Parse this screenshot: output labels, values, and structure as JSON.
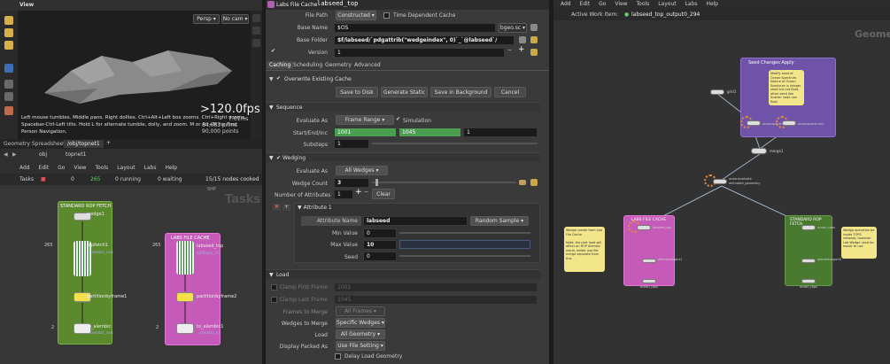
{
  "viewport": {
    "title": "View",
    "persp": "Persp",
    "cam": "No cam",
    "fps": ">120.0fps",
    "ms": "7.01ms",
    "stats1": "84,681   prims",
    "stats2": "90,000  points",
    "hint": "Left mouse tumbles. Middle pans. Right dollies. Ctrl+Alt+Left box zooms. Ctrl+Right zooms. Spacebar-Ctrl-Left tilts. Hold L for alternate tumble, dolly, and zoom. M or Alt+M for First Person Navigation."
  },
  "network_left": {
    "tabs": [
      "Geometry Spreadsheet",
      "/obj/topnet1"
    ],
    "path": [
      "obj",
      "topnet1"
    ],
    "menu": [
      "Add",
      "Edit",
      "Go",
      "View",
      "Tools",
      "Layout",
      "Labs",
      "Help"
    ],
    "tasks_label": "Tasks",
    "counts": [
      "0",
      "265",
      "0 running",
      "0 waiting"
    ],
    "cooked": "15/15 nodes cooked",
    "ship": "SHP",
    "watermark": "Tasks",
    "box_rop": "STANDARD ROP FETCH",
    "box_cache": "LABS FILE CACHE",
    "nodes": [
      {
        "name": "wedge1",
        "count": ""
      },
      {
        "name": "ropfetch1",
        "count": "265",
        "sub": ".../aembic_variant_TOPS/sceneT ..."
      },
      {
        "name": "partitionbyframe1",
        "count": ""
      },
      {
        "name": "to_alembic",
        "count": "2",
        "sub": ".../aembic_variant_TOPS/scen..."
      },
      {
        "name": "labseed_top",
        "count": "265",
        "sub": "$JOB/geo_v1_001.bgeo.sc"
      },
      {
        "name": "partitionbyframe2",
        "count": ""
      },
      {
        "name": "to_alembic1",
        "count": "2",
        "sub": ".../aembic_variant_TOPS/nwedg..."
      }
    ]
  },
  "params": {
    "type": "Labs File Cache",
    "name": "labseed_top",
    "file_path_label": "File Path",
    "file_path_value": "Constructed",
    "time_dep": "Time Dependent Cache",
    "base_name_label": "Base Name",
    "base_name_value": "$OS",
    "ext": "bgeo.sc",
    "base_folder_label": "Base Folder",
    "base_folder_value": "$f/labseed/`pdgattrib(\"wedgeindex\", 0)`_`@labseed`/",
    "version_label": "Version",
    "version_value": "1",
    "tabs": [
      "Caching",
      "Scheduling",
      "Geometry",
      "Advanced"
    ],
    "overwrite": "Overwrite Existing Cache",
    "buttons": [
      "Save to Disk",
      "Generate Static",
      "Save in Background",
      "Cancel"
    ],
    "sequence": "Sequence",
    "evaluate_label": "Evaluate As",
    "evaluate_value": "Frame Range",
    "simulation": "Simulation",
    "sei_label": "Start/End/Inc",
    "start": "1001",
    "end": "1045",
    "inc": "1",
    "substeps_label": "Substeps",
    "substeps": "1",
    "wedging": "Wedging",
    "wedge_eval_label": "Evaluate As",
    "wedge_eval": "All Wedges",
    "wedge_count_label": "Wedge Count",
    "wedge_count": "3",
    "num_attr_label": "Number of Attributes",
    "num_attr": "1",
    "clear": "Clear",
    "attribute": "Attribute 1",
    "attr_name_label": "Attribute Name",
    "attr_name": "labseed",
    "attr_mode": "Random Sample",
    "min_label": "Min Value",
    "min": "0",
    "max_label": "Max Value",
    "max": "10",
    "seed_label": "Seed",
    "seed": "0",
    "load": "Load",
    "clamp_first_label": "Clamp First Frame",
    "clamp_first": "1001",
    "clamp_last_label": "Clamp Last Frame",
    "clamp_last": "1045",
    "frames_merge_label": "Frames to Merge",
    "frames_merge": "All Frames",
    "wedges_merge_label": "Wedges to Merge",
    "wedges_merge": "Specific Wedges",
    "load_label": "Load",
    "load_value": "All Geometry",
    "display_label": "Display Packed As",
    "display_value": "Use File Setting",
    "delay": "Delay Load Geometry"
  },
  "network_right": {
    "menu": [
      "Add",
      "Edit",
      "Go",
      "View",
      "Tools",
      "Layout",
      "Labs",
      "Help"
    ],
    "work_item_label": "Active Work Item:",
    "work_item": "labseed_top_output0_294",
    "watermark": "Geome",
    "seed_box": "Seed Changes Apply",
    "seed_note": "Modify seed of Ocean Spectrum. Nature of Ocean Spectrum is integer seed but not float, other seed like Scatter node use float",
    "box_cache": "LABS FILE CACHE",
    "box_rop": "STANDARD ROP FETCH",
    "notes": [
      "Wedge create from Lab File Cache\n\nNote: the part load will affect on ROP Alembic result, better use file merge separate from this",
      "Wedge operation be inside TOPS network, however Lab Wedge used for easier to use"
    ],
    "nodes": [
      "grid1",
      "oceanspectrum1",
      "oceanspectrum2",
      "merge1",
      "oceanevaluate",
      "animated_geometry",
      "labseed_top",
      "ocean_tops",
      "alembicexport1",
      "alembicexport2",
      "ocean_tops",
      "ocean_tops"
    ]
  }
}
